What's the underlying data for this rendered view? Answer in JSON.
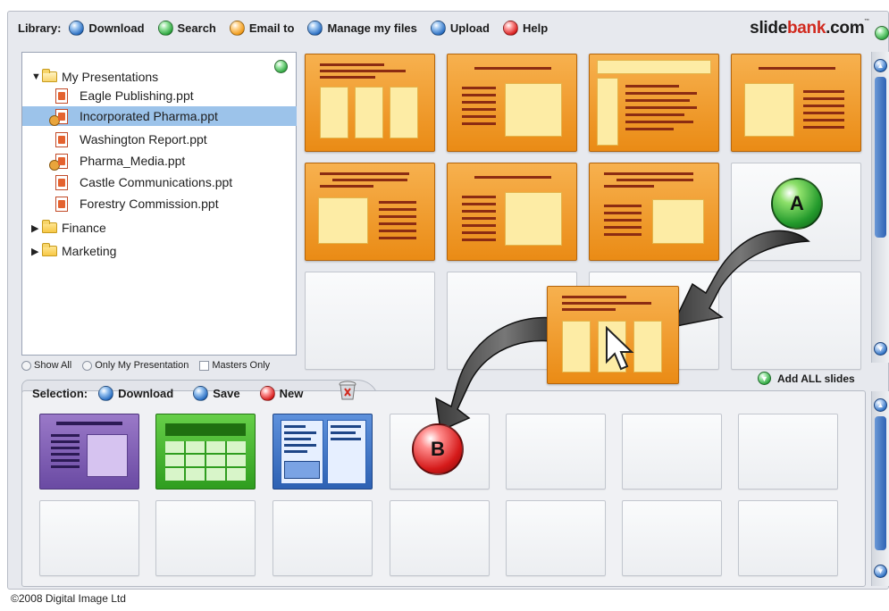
{
  "menu": {
    "library_label": "Library:",
    "items": [
      {
        "label": "Download",
        "color": "#2b6fc2"
      },
      {
        "label": "Search",
        "color": "#2ea640"
      },
      {
        "label": "Email to",
        "color": "#f09a18"
      },
      {
        "label": "Manage my files",
        "color": "#2b6fc2"
      },
      {
        "label": "Upload",
        "color": "#2b6fc2"
      },
      {
        "label": "Help",
        "color": "#d81f1f"
      }
    ]
  },
  "logo": {
    "part1": "slide",
    "part2": "bank",
    "part3": ".com",
    "tm": "™"
  },
  "tree": {
    "root": "My Presentations",
    "files": [
      "Eagle Publishing.ppt",
      "Incorporated Pharma.ppt",
      "Washington Report.ppt",
      "Pharma_Media.ppt",
      "Castle Communications.ppt",
      "Forestry Commission.ppt"
    ],
    "selected_file": "Incorporated Pharma.ppt",
    "folders": [
      "Finance",
      "Marketing"
    ]
  },
  "filters": {
    "show_all": "Show All",
    "only_my": "Only My Presentation",
    "masters_only": "Masters Only"
  },
  "add_all": "Add ALL slides",
  "selection": {
    "label": "Selection:",
    "download": "Download",
    "save": "Save",
    "new": "New"
  },
  "badges": {
    "a": "A",
    "b": "B"
  },
  "footer": "©2008 Digital Image Ltd",
  "colors": {
    "slide_orange": "#ea8b15",
    "accent_red": "#d12a1f",
    "select_blue": "#9cc3ea"
  }
}
